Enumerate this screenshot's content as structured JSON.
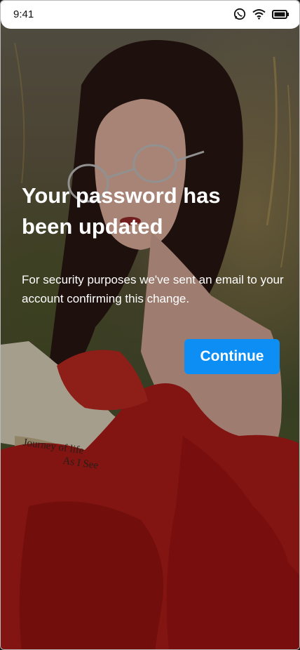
{
  "status_bar": {
    "time": "9:41",
    "icons": [
      "whatsapp-icon",
      "wifi-icon",
      "battery-icon"
    ]
  },
  "message": {
    "title": "Your password has been updated",
    "body": "For security purposes we've sent an email to your account confirming this change."
  },
  "actions": {
    "continue_label": "Continue"
  },
  "background": {
    "book_text": [
      "Journey of life",
      "As I See"
    ]
  },
  "colors": {
    "accent": "#0d8ef5",
    "text": "#ffffff",
    "dress": "#c0201c"
  }
}
